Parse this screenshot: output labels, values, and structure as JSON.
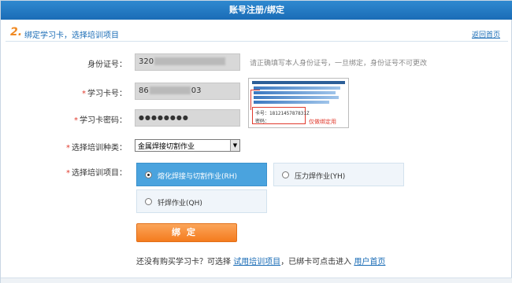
{
  "window": {
    "title": "账号注册/绑定"
  },
  "step": {
    "number": "2.",
    "title": "绑定学习卡，选择培训项目",
    "back_link": "返回首页"
  },
  "form": {
    "id_label": "身份证号：",
    "id_value": "320",
    "id_hint": "请正确填写本人身份证号，一旦绑定，身份证号不可更改",
    "card_label": "学习卡号：",
    "card_prefix": "86",
    "card_suffix": "03",
    "password_label": "学习卡密码：",
    "password_value": "●●●●●●●●",
    "category_label": "选择培训种类：",
    "category_value": "金属焊接切割作业",
    "project_label": "选择培训项目："
  },
  "card_example": {
    "card_no": "卡号：1812145787831Z",
    "password": "密码：",
    "note": "仅做绑定用"
  },
  "options": [
    {
      "label": "熔化焊接与切割作业(RH)",
      "selected": true
    },
    {
      "label": "压力焊作业(YH)",
      "selected": false
    },
    {
      "label": "钎焊作业(QH)",
      "selected": false
    }
  ],
  "submit_label": "绑定",
  "bottom": {
    "text1": "还没有购买学习卡？可选择",
    "link1": "试用培训项目",
    "text2": "，已绑卡可点击进入",
    "link2": "用户首页"
  }
}
